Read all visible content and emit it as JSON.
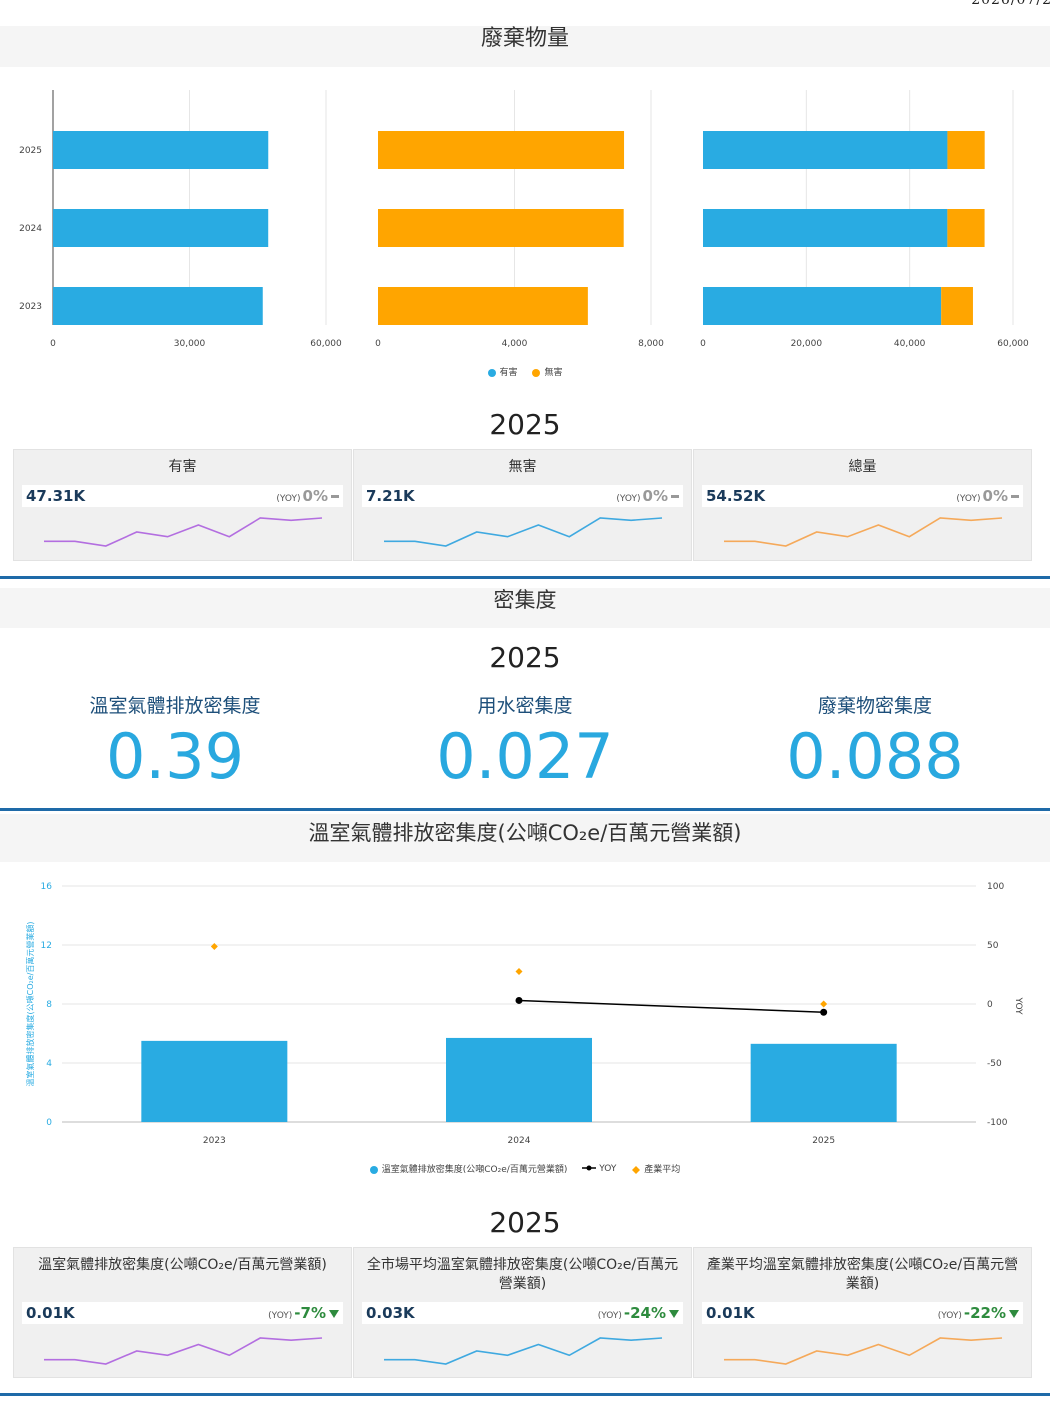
{
  "date_stamp": "2026/07/2",
  "waste": {
    "title": "廢棄物量",
    "legend": [
      {
        "label": "有害",
        "color": "#29abe2"
      },
      {
        "label": "無害",
        "color": "#ffa500"
      }
    ],
    "chart_data": [
      {
        "type": "bar",
        "orientation": "horizontal",
        "categories": [
          "2025",
          "2024",
          "2023"
        ],
        "series": [
          {
            "name": "有害",
            "values": [
              47310,
              47300,
              46100
            ]
          }
        ],
        "xlim": [
          0,
          60000
        ],
        "xticks": [
          "0",
          "30,000",
          "60,000"
        ]
      },
      {
        "type": "bar",
        "orientation": "horizontal",
        "categories": [
          "2025",
          "2024",
          "2023"
        ],
        "series": [
          {
            "name": "無害",
            "values": [
              7210,
              7200,
              6150
            ]
          }
        ],
        "xlim": [
          0,
          8000
        ],
        "xticks": [
          "0",
          "4,000",
          "8,000"
        ]
      },
      {
        "type": "bar",
        "stacked": true,
        "orientation": "horizontal",
        "categories": [
          "2025",
          "2024",
          "2023"
        ],
        "series": [
          {
            "name": "有害",
            "values": [
              47310,
              47300,
              46100
            ]
          },
          {
            "name": "無害",
            "values": [
              7210,
              7200,
              6150
            ]
          }
        ],
        "xlim": [
          0,
          60000
        ],
        "xticks": [
          "0",
          "20,000",
          "40,000",
          "60,000"
        ]
      }
    ]
  },
  "waste_kpi": {
    "year": "2025",
    "cards": [
      {
        "title": "有害",
        "value": "47.31K",
        "yoy_tag": "(YOY)",
        "yoy": "0%",
        "trend": "flat",
        "color": "#b36ee0",
        "spark": [
          40,
          40,
          38,
          44,
          42,
          47,
          42,
          50,
          49,
          50
        ]
      },
      {
        "title": "無害",
        "value": "7.21K",
        "yoy_tag": "(YOY)",
        "yoy": "0%",
        "trend": "flat",
        "color": "#3fa9e0",
        "spark": [
          40,
          40,
          38,
          44,
          42,
          47,
          42,
          50,
          49,
          50
        ]
      },
      {
        "title": "總量",
        "value": "54.52K",
        "yoy_tag": "(YOY)",
        "yoy": "0%",
        "trend": "flat",
        "color": "#f5a95a",
        "spark": [
          40,
          40,
          38,
          44,
          42,
          47,
          42,
          50,
          49,
          50
        ]
      }
    ]
  },
  "intensity": {
    "title": "密集度",
    "year": "2025",
    "metrics": [
      {
        "label": "溫室氣體排放密集度",
        "value": "0.39"
      },
      {
        "label": "用水密集度",
        "value": "0.027"
      },
      {
        "label": "廢棄物密集度",
        "value": "0.088"
      }
    ]
  },
  "ghg": {
    "title": "溫室氣體排放密集度(公噸CO₂e/百萬元營業額)",
    "legend": [
      {
        "label": "溫室氣體排放密集度(公噸CO₂e/百萬元營業額)",
        "color": "#29abe2",
        "kind": "dot"
      },
      {
        "label": "YOY",
        "color": "#000000",
        "kind": "line"
      },
      {
        "label": "產業平均",
        "color": "#ffa500",
        "kind": "diamond"
      }
    ],
    "chart_data": {
      "type": "bar",
      "categories": [
        "2023",
        "2024",
        "2025"
      ],
      "series": [
        {
          "name": "溫室氣體排放密集度(公噸CO₂e/百萬元營業額)",
          "axis": "left",
          "values": [
            5.5,
            5.7,
            5.3
          ]
        },
        {
          "name": "YOY",
          "axis": "right",
          "type": "line",
          "values": [
            null,
            3,
            -7
          ]
        },
        {
          "name": "產業平均",
          "axis": "left",
          "type": "scatter",
          "values": [
            11.9,
            10.2,
            8.0
          ]
        }
      ],
      "ylabel": "溫室氣體排放密集度(公噸CO₂e/百萬元營業額)",
      "ylim": [
        0,
        16
      ],
      "yticks": [
        0,
        4,
        8,
        12,
        16
      ],
      "y2label": "YOY",
      "y2lim": [
        -100,
        100
      ],
      "y2ticks": [
        -100,
        -50,
        0,
        50,
        100
      ]
    }
  },
  "ghg_kpi": {
    "year": "2025",
    "cards": [
      {
        "title": "溫室氣體排放密集度(公噸CO₂e/百萬元營業額)",
        "value": "0.01K",
        "yoy_tag": "(YOY)",
        "yoy": "-7%",
        "trend": "down",
        "color": "#b36ee0",
        "spark": [
          40,
          40,
          38,
          44,
          42,
          47,
          42,
          50,
          49,
          50
        ]
      },
      {
        "title": "全市場平均溫室氣體排放密集度(公噸CO₂e/百萬元營業額)",
        "value": "0.03K",
        "yoy_tag": "(YOY)",
        "yoy": "-24%",
        "trend": "down",
        "color": "#3fa9e0",
        "spark": [
          40,
          40,
          38,
          44,
          42,
          47,
          42,
          50,
          49,
          50
        ]
      },
      {
        "title": "產業平均溫室氣體排放密集度(公噸CO₂e/百萬元營業額)",
        "value": "0.01K",
        "yoy_tag": "(YOY)",
        "yoy": "-22%",
        "trend": "down",
        "color": "#f5a95a",
        "spark": [
          40,
          40,
          38,
          44,
          42,
          47,
          42,
          50,
          49,
          50
        ]
      }
    ]
  }
}
